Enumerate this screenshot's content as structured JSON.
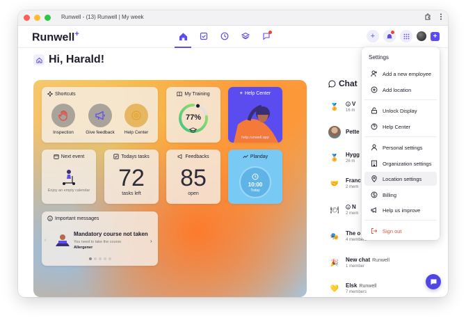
{
  "window": {
    "title": "Runwell - (13) Runwell | My week"
  },
  "app": {
    "logo_text": "Runwell",
    "logo_mark": "+",
    "greeting": "Hi, Harald!",
    "accent": "#5b4cf0"
  },
  "nav": {
    "icons": [
      "home-icon",
      "checklist-icon",
      "clock-icon",
      "layers-icon",
      "chat-bubble-icon"
    ]
  },
  "shortcuts": {
    "title": "Shortcuts",
    "items": [
      {
        "label": "Inspection",
        "icon": "hand-stop-icon"
      },
      {
        "label": "Give feedback",
        "icon": "megaphone-icon"
      },
      {
        "label": "Help Center",
        "icon": "lifebuoy-icon"
      }
    ]
  },
  "training": {
    "title": "My Training",
    "percent_text": "77%",
    "progress": 0.77
  },
  "help_center": {
    "title": "Help Center",
    "url": "help.runwell.app"
  },
  "next_event": {
    "title": "Next event",
    "empty_text": "Enjoy an empty calendar"
  },
  "todays_tasks": {
    "title": "Todays tasks",
    "count": "72",
    "sub": "tasks left"
  },
  "feedbacks": {
    "title": "Feedbacks",
    "count": "85",
    "sub": "open"
  },
  "planday": {
    "title": "Planday",
    "time": "10:00",
    "day": "Today"
  },
  "important": {
    "title": "Important messages",
    "headline": "Mandatory course not taken",
    "body": "You need to take the course",
    "course": "Allergener",
    "page_dots": 5
  },
  "chat": {
    "title": "Chat",
    "items": [
      {
        "name": "V",
        "meta": "16 m",
        "avatar": "medal-icon"
      },
      {
        "name": "Pette",
        "meta": "",
        "avatar": "person-photo"
      },
      {
        "name": "Hygg",
        "meta": "26 m",
        "avatar": "medal-icon"
      },
      {
        "name": "Franc",
        "meta": "2 mem",
        "avatar": "handshake-icon"
      },
      {
        "name": "N",
        "meta": "2 mem",
        "avatar": "plate-icon"
      },
      {
        "name": "The o",
        "meta": "4 members",
        "avatar": "mask-icon"
      },
      {
        "name": "New chat",
        "org": "Runwell",
        "meta": "1 member",
        "avatar": "party-icon"
      },
      {
        "name": "Elsk",
        "org": "Runwell",
        "meta": "7 members",
        "avatar": "heart-icon"
      }
    ]
  },
  "settings_menu": {
    "title": "Settings",
    "items": [
      {
        "label": "Add a new employee",
        "icon": "add-user-icon"
      },
      {
        "label": "Add location",
        "icon": "add-circle-icon"
      },
      {
        "label": "Unlock Display",
        "icon": "unlock-icon"
      },
      {
        "label": "Help Center",
        "icon": "help-circle-icon"
      },
      {
        "label": "Personal settings",
        "icon": "person-icon"
      },
      {
        "label": "Organization settings",
        "icon": "building-icon"
      },
      {
        "label": "Location settings",
        "icon": "location-pin-icon"
      },
      {
        "label": "Billing",
        "icon": "dollar-icon"
      },
      {
        "label": "Help us improve",
        "icon": "megaphone-icon"
      },
      {
        "label": "Sign out",
        "icon": "sign-out-icon"
      }
    ]
  }
}
